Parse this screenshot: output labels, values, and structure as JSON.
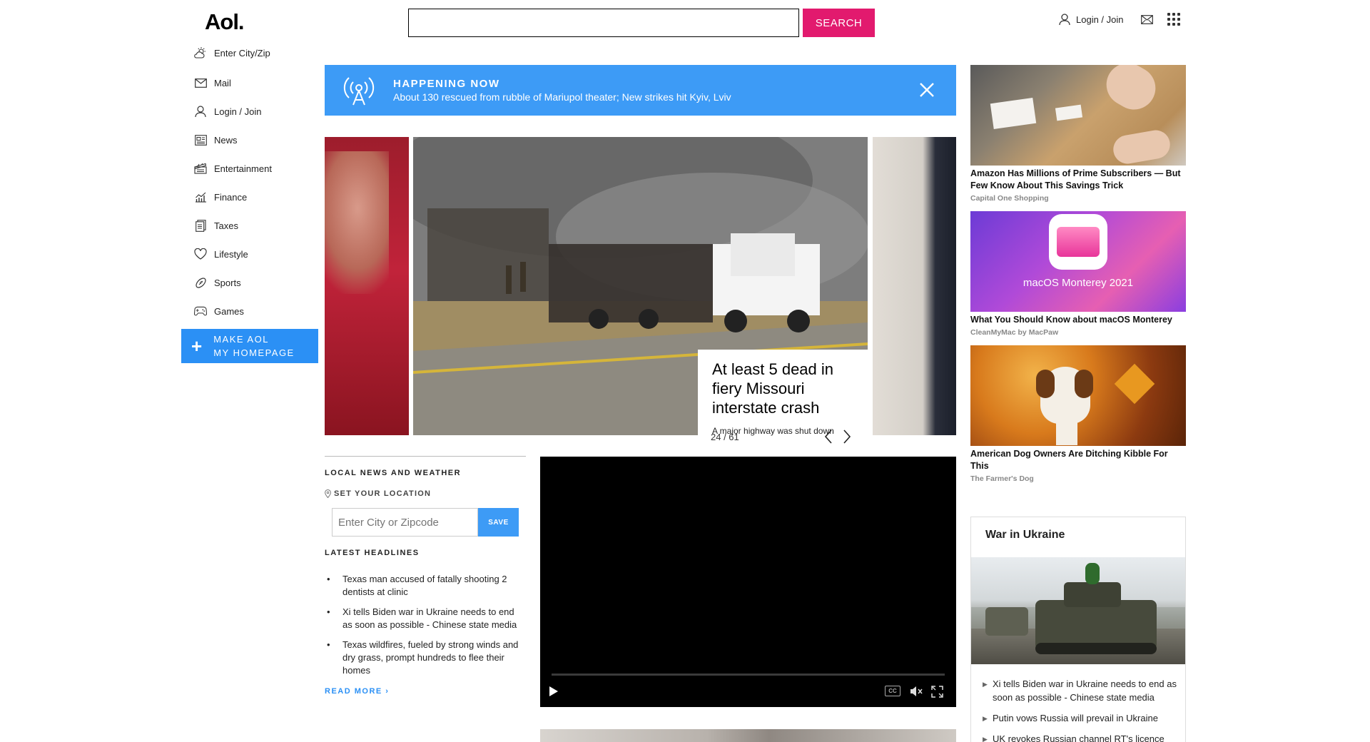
{
  "header": {
    "logo": "Aol.",
    "search": {
      "value": "",
      "placeholder": "",
      "button_label": "SEARCH"
    },
    "login_label": "Login / Join"
  },
  "sidebar": {
    "items": [
      {
        "label": "Enter City/Zip",
        "icon": "weather-icon"
      },
      {
        "label": "Mail",
        "icon": "mail-icon"
      },
      {
        "label": "Login / Join",
        "icon": "user-icon"
      },
      {
        "label": "News",
        "icon": "news-icon"
      },
      {
        "label": "Entertainment",
        "icon": "clapper-icon"
      },
      {
        "label": "Finance",
        "icon": "chart-icon"
      },
      {
        "label": "Taxes",
        "icon": "document-icon"
      },
      {
        "label": "Lifestyle",
        "icon": "heart-icon"
      },
      {
        "label": "Sports",
        "icon": "football-icon"
      },
      {
        "label": "Games",
        "icon": "gamepad-icon"
      }
    ],
    "make_homepage": {
      "line1": "MAKE AOL",
      "line2": "MY HOMEPAGE"
    }
  },
  "banner": {
    "title": "HAPPENING NOW",
    "text": "About 130 rescued from rubble of Mariupol theater; New strikes hit Kyiv, Lviv"
  },
  "carousel": {
    "title": "At least 5 dead in fiery Missouri interstate crash",
    "description": "A major highway was shut down following an accident that may",
    "counter": "24 / 61"
  },
  "local": {
    "heading": "LOCAL NEWS AND WEATHER",
    "location_label": "SET YOUR LOCATION",
    "zip_placeholder": "Enter City or Zipcode",
    "save_label": "SAVE"
  },
  "latest": {
    "heading": "LATEST HEADLINES",
    "items": [
      "Texas man accused of fatally shooting 2 dentists at clinic",
      "Xi tells Biden war in Ukraine needs to end as soon as possible - Chinese state media",
      "Texas wildfires, fueled by strong winds and dry grass, prompt hundreds to flee their homes"
    ],
    "read_more": "READ MORE ›"
  },
  "video": {
    "cc_label": "CC"
  },
  "ads": [
    {
      "title": "Amazon Has Millions of Prime Subscribers — But Few Know About This Savings Trick",
      "source": "Capital One Shopping"
    },
    {
      "title": "What You Should Know about macOS Monterey",
      "source": "CleanMyMac by MacPaw",
      "image_text": "macOS Monterey 2021"
    },
    {
      "title": "American Dog Owners Are Ditching Kibble For This",
      "source": "The Farmer's Dog"
    }
  ],
  "ukraine": {
    "title": "War in Ukraine",
    "items": [
      "Xi tells Biden war in Ukraine needs to end as soon as possible - Chinese state media",
      "Putin vows Russia will prevail in Ukraine",
      "UK revokes Russian channel RT's licence"
    ]
  },
  "colors": {
    "search_button": "#e21a6e",
    "banner": "#3d9bf6",
    "accent": "#2b90f5"
  }
}
